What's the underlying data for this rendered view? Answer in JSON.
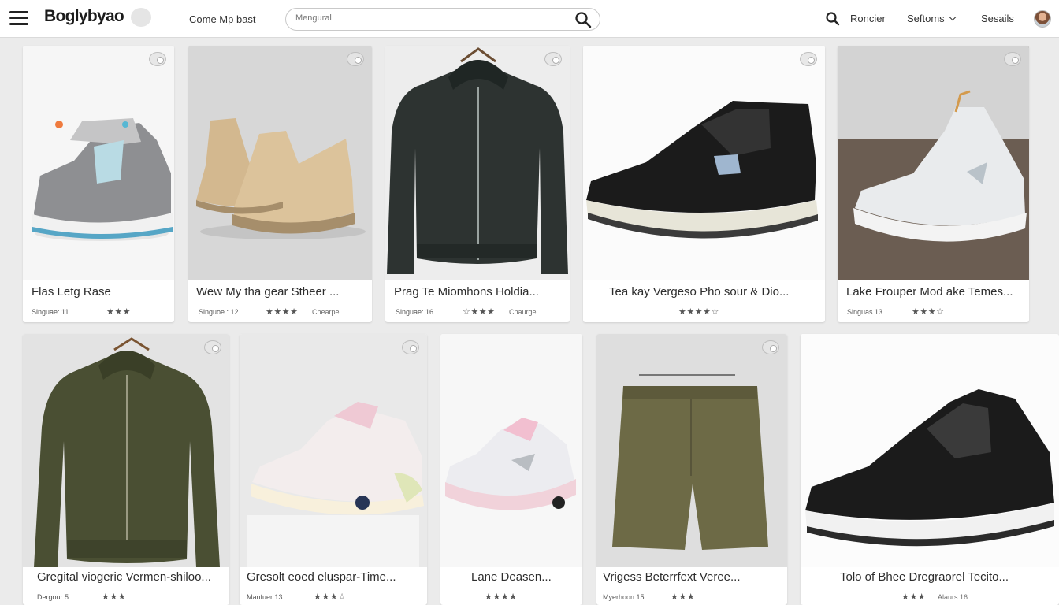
{
  "header": {
    "logo": "Boglybyao",
    "nav_link": "Come Mp bast",
    "search_placeholder": "Mengural",
    "links": [
      "Roncier",
      "Seftoms",
      "Sesails"
    ]
  },
  "products": [
    {
      "title": "Flas Letg Rase",
      "meta": "Singuae: 11",
      "stars": "★★★",
      "tag": ""
    },
    {
      "title": "Wew My tha gear Stheer ...",
      "meta": "Singuoe : 12",
      "stars": "★★★★",
      "tag": "Chearpe"
    },
    {
      "title": "Prag Te Miomhons Holdia...",
      "meta": "Singuae: 16",
      "stars": "☆★★★",
      "tag": "Chaurge"
    },
    {
      "title": "Tea kay Vergeso Pho sour & Dio...",
      "meta": "",
      "stars": "★★★★☆",
      "tag": ""
    },
    {
      "title": "Lake Frouper Mod ake Temes...",
      "meta": "Singuas 13",
      "stars": "★★★☆",
      "tag": ""
    },
    {
      "title": "Gregital viogeric Vermen-shiloo...",
      "meta": "Dergour 5",
      "stars": "★★★",
      "tag": ""
    },
    {
      "title": "Gresolt eoed eluspar-Time...",
      "meta": "Manfuer 13",
      "stars": "★★★☆",
      "tag": ""
    },
    {
      "title": "Lane Deasen...",
      "meta": "",
      "stars": "★★★★",
      "tag": ""
    },
    {
      "title": "Vrigess Beterrfext Veree...",
      "meta": "Myerhoon 15",
      "stars": "★★★",
      "tag": ""
    },
    {
      "title": "Tolo of Bhee Dregraorel Tecito...",
      "meta": "",
      "stars": "★★★",
      "tag": "Alaurs 16"
    }
  ]
}
